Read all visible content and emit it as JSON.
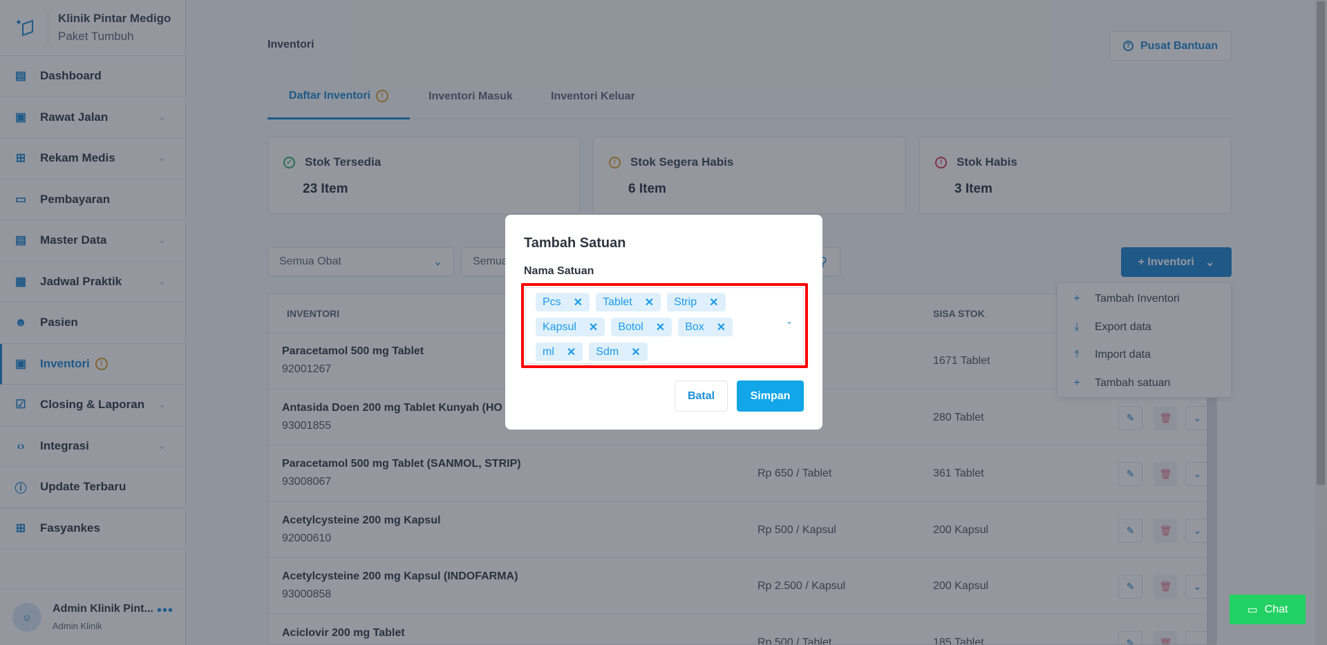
{
  "sidebar": {
    "brand_name": "Klinik Pintar Medigo",
    "brand_plan": "Paket Tumbuh",
    "items": [
      {
        "label": "Dashboard",
        "icon": "dashboard-icon",
        "chevron": false
      },
      {
        "label": "Rawat Jalan",
        "icon": "outpatient-icon",
        "chevron": true
      },
      {
        "label": "Rekam Medis",
        "icon": "folder-plus-icon",
        "chevron": true
      },
      {
        "label": "Pembayaran",
        "icon": "payment-icon",
        "chevron": false
      },
      {
        "label": "Master Data",
        "icon": "database-icon",
        "chevron": true
      },
      {
        "label": "Jadwal Praktik",
        "icon": "calendar-icon",
        "chevron": true
      },
      {
        "label": "Pasien",
        "icon": "user-icon",
        "chevron": false
      },
      {
        "label": "Inventori",
        "icon": "archive-icon",
        "chevron": false,
        "active": true,
        "warning": true
      },
      {
        "label": "Closing & Laporan",
        "icon": "clipboard-check-icon",
        "chevron": true
      },
      {
        "label": "Integrasi",
        "icon": "code-icon",
        "chevron": true
      },
      {
        "label": "Update Terbaru",
        "icon": "alert-circle-icon",
        "chevron": false
      },
      {
        "label": "Fasyankes",
        "icon": "hospital-icon",
        "chevron": false
      }
    ],
    "user_name": "Admin Klinik Pint...",
    "user_role": "Admin Klinik"
  },
  "header": {
    "title": "Inventori",
    "help_label": "Pusat Bantuan"
  },
  "tabs": [
    {
      "label": "Daftar Inventori",
      "active": true
    },
    {
      "label": "Inventori Masuk"
    },
    {
      "label": "Inventori Keluar"
    }
  ],
  "stats": [
    {
      "label": "Stok Tersedia",
      "value": "23 Item",
      "color": "#3cb371"
    },
    {
      "label": "Stok Segera Habis",
      "value": "6 Item",
      "color": "#e0a43a"
    },
    {
      "label": "Stok Habis",
      "value": "3 Item",
      "color": "#d9466b"
    }
  ],
  "filters": {
    "select1": "Semua Obat",
    "select2": "Semua"
  },
  "add_button": "+ Inventori",
  "dropdown": [
    {
      "label": "Tambah Inventori",
      "icon": "plus-icon"
    },
    {
      "label": "Export data",
      "icon": "download-icon"
    },
    {
      "label": "Import data",
      "icon": "upload-icon"
    },
    {
      "label": "Tambah satuan",
      "icon": "plus-icon"
    }
  ],
  "table": {
    "headers": [
      "INVENTORI",
      "SISA STOK"
    ],
    "rows": [
      {
        "name": "Paracetamol 500 mg Tablet",
        "code": "92001267",
        "price": "let",
        "stock": "1671 Tablet"
      },
      {
        "name": "Antasida Doen 200 mg Tablet Kunyah (HO",
        "code": "93001855",
        "price": "blet",
        "stock": "280 Tablet"
      },
      {
        "name": "Paracetamol 500 mg Tablet (SANMOL, STRIP)",
        "code": "93008067",
        "price": "Rp 650 / Tablet",
        "stock": "361 Tablet"
      },
      {
        "name": "Acetylcysteine 200 mg Kapsul",
        "code": "92000610",
        "price": "Rp 500 / Kapsul",
        "stock": "200 Kapsul"
      },
      {
        "name": "Acetylcysteine 200 mg Kapsul (INDOFARMA)",
        "code": "93000858",
        "price": "Rp 2.500 / Kapsul",
        "stock": "200 Kapsul"
      },
      {
        "name": "Aciclovir 200 mg Tablet",
        "code": "",
        "price": "Rp 500 / Tablet",
        "stock": "185 Tablet"
      }
    ]
  },
  "chat_label": "Chat",
  "modal": {
    "title": "Tambah Satuan",
    "field_label": "Nama Satuan",
    "chips": [
      "Pcs",
      "Tablet",
      "Strip",
      "Kapsul",
      "Botol",
      "Box",
      "ml",
      "Sdm"
    ],
    "cancel": "Batal",
    "save": "Simpan",
    "highlight_color": "#ff0000",
    "accent": "#12a5e8"
  }
}
